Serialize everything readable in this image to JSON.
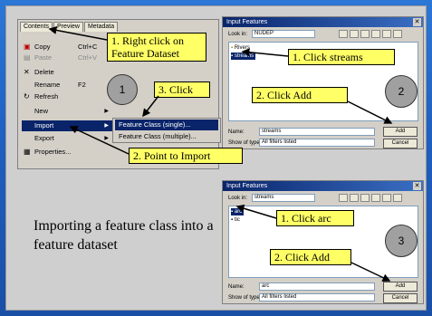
{
  "menu": {
    "tabs": [
      "Contents",
      "Preview",
      "Metadata"
    ],
    "items": [
      {
        "label": "Copy",
        "shortcut": "Ctrl+C",
        "icon": "copy-icon"
      },
      {
        "label": "Paste",
        "shortcut": "Ctrl+V",
        "icon": "paste-icon"
      },
      {
        "label": "Delete",
        "shortcut": "",
        "icon": "delete-icon"
      },
      {
        "label": "Rename",
        "shortcut": "F2",
        "icon": ""
      },
      {
        "label": "Refresh",
        "shortcut": "",
        "icon": "refresh-icon"
      },
      {
        "label": "New",
        "shortcut": "",
        "icon": ""
      },
      {
        "label": "Import",
        "shortcut": "",
        "icon": ""
      },
      {
        "label": "Export",
        "shortcut": "",
        "icon": ""
      },
      {
        "label": "Properties...",
        "shortcut": "",
        "icon": "properties-icon"
      }
    ],
    "submenu": [
      "Feature Class (single)...",
      "Feature Class (multiple)..."
    ]
  },
  "dialog1": {
    "title": "Input Features",
    "look_in_label": "Look in:",
    "look_in_value": "NUDEP",
    "list": [
      "Rivers",
      "streams"
    ],
    "name_label": "Name:",
    "name_value": "streams",
    "type_label": "Show of type:",
    "type_value": "All filters listed",
    "add_label": "Add",
    "cancel_label": "Cancel"
  },
  "dialog2": {
    "title": "Input Features",
    "look_in_label": "Look in:",
    "look_in_value": "streams",
    "list": [
      "arc",
      "tic"
    ],
    "name_label": "Name:",
    "name_value": "arc",
    "type_label": "Show of type:",
    "type_value": "All filters listed",
    "add_label": "Add",
    "cancel_label": "Cancel"
  },
  "callouts": {
    "right_click": "1. Right click on Feature Dataset",
    "click3": "3. Click",
    "point_import": "2. Point to Import",
    "click_streams": "1. Click streams",
    "click_add_1": "2. Click Add",
    "click_arc": "1. Click arc",
    "click_add_2": "2. Click Add"
  },
  "steps": [
    "1",
    "2",
    "3"
  ],
  "caption": "Importing a feature class into a feature dataset",
  "colors": {
    "slide_blue": "#1f5fbf",
    "panel_gray": "#cfcfcf",
    "callout_yellow": "#ffff66",
    "highlight_blue": "#0a246a"
  }
}
